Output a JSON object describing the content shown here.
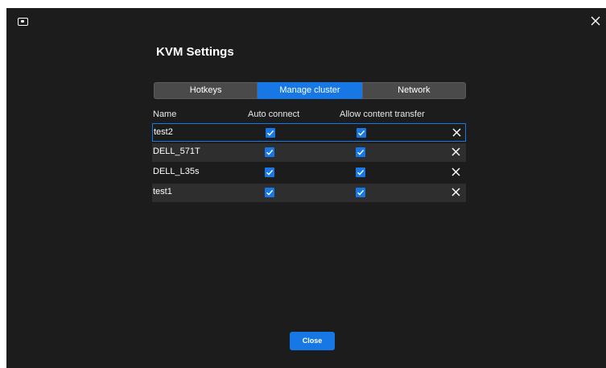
{
  "window": {
    "title": "KVM Settings",
    "close_icon": "close-icon",
    "app_icon": "monitor-icon"
  },
  "tabs": [
    {
      "label": "Hotkeys",
      "active": false
    },
    {
      "label": "Manage cluster",
      "active": true
    },
    {
      "label": "Network",
      "active": false
    }
  ],
  "table": {
    "columns": {
      "name": "Name",
      "auto_connect": "Auto connect",
      "allow_transfer": "Allow content transfer"
    },
    "rows": [
      {
        "name": "test2",
        "auto_connect": true,
        "allow_transfer": true,
        "selected": true
      },
      {
        "name": "DELL_571T",
        "auto_connect": true,
        "allow_transfer": true,
        "selected": false
      },
      {
        "name": "DELL_L35s",
        "auto_connect": true,
        "allow_transfer": true,
        "selected": false
      },
      {
        "name": "test1",
        "auto_connect": true,
        "allow_transfer": true,
        "selected": false
      }
    ]
  },
  "footer": {
    "close_label": "Close"
  },
  "colors": {
    "accent": "#1677e5",
    "background": "#1c1c1c",
    "row_alt": "#2e2e2e",
    "tab_inactive": "#4a4a4a"
  }
}
